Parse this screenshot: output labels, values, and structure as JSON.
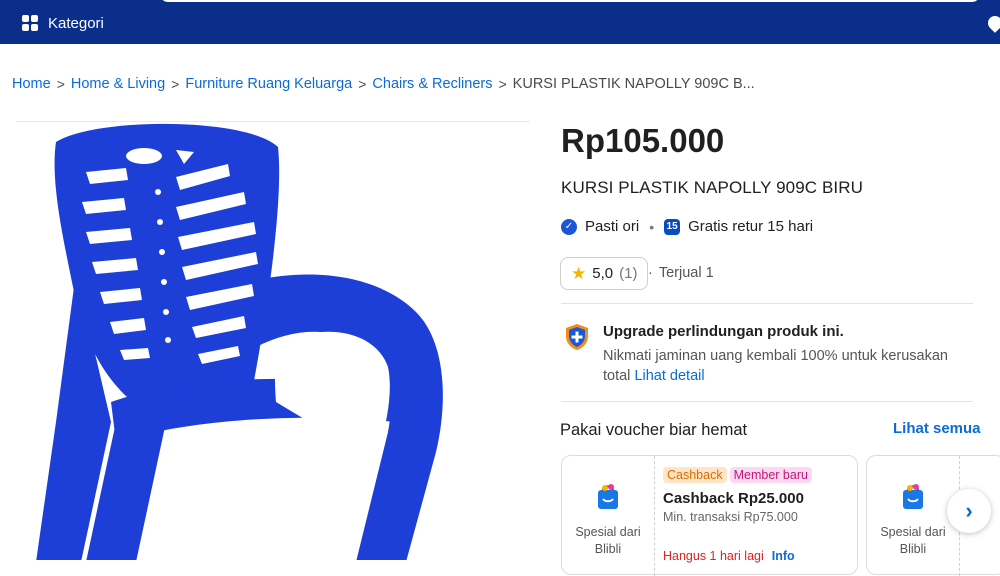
{
  "header": {
    "kategori_label": "Kategori"
  },
  "breadcrumb": {
    "items": [
      "Home",
      "Home & Living",
      "Furniture Ruang Keluarga",
      "Chairs & Recliners"
    ],
    "current": "KURSI PLASTIK NAPOLLY 909C B..."
  },
  "product": {
    "price": "Rp105.000",
    "title": "KURSI PLASTIK NAPOLLY 909C BIRU",
    "image_color": "#1d3fd8",
    "badges": {
      "pasti_ori": "Pasti ori",
      "retur": "Gratis retur 15 hari"
    },
    "rating": {
      "score": "5,0",
      "count": "(1)"
    },
    "sold": "Terjual 1"
  },
  "protection": {
    "title": "Upgrade perlindungan produk ini.",
    "desc": "Nikmati jaminan uang kembali 100% untuk kerusakan total",
    "link": "Lihat detail"
  },
  "vouchers": {
    "heading": "Pakai voucher biar hemat",
    "see_all": "Lihat semua",
    "cards": [
      {
        "left_label_1": "Spesial dari",
        "left_label_2": "Blibli",
        "tag_1": "Cashback",
        "tag_2": "Member baru",
        "title": "Cashback Rp25.000",
        "min": "Min. transaksi Rp75.000",
        "expiry": "Hangus 1 hari lagi",
        "info": "Info"
      },
      {
        "left_label_1": "Spesial dari",
        "left_label_2": "Blibli"
      }
    ]
  },
  "colors": {
    "header_bg": "#0a2e8a",
    "link": "#0a6cd6",
    "accent_orange": "#e06a00",
    "accent_pink": "#c2187a",
    "expiry_red": "#e02020"
  }
}
